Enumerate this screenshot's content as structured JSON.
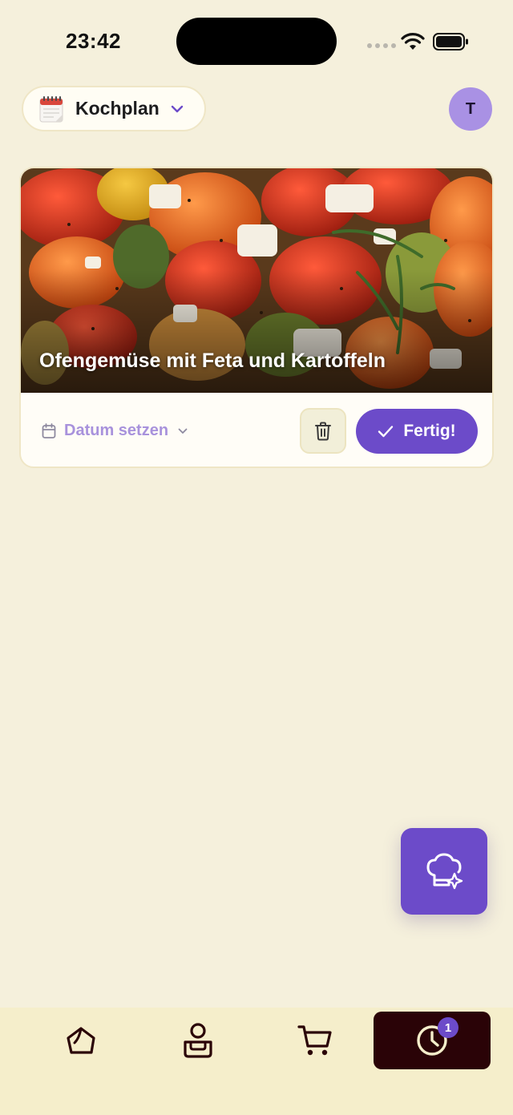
{
  "status_bar": {
    "time": "23:42"
  },
  "header": {
    "plan_selector_label": "Kochplan",
    "avatar_initial": "T"
  },
  "recipe_card": {
    "title": "Ofengemüse mit Feta und Kartoffeln",
    "date_label": "Datum setzen",
    "done_label": "Fertig!"
  },
  "bottom_nav": {
    "items": [
      {
        "icon": "home-icon"
      },
      {
        "icon": "profile-icon"
      },
      {
        "icon": "cart-icon"
      },
      {
        "icon": "history-clock-icon",
        "badge": "1",
        "active": true
      }
    ]
  },
  "colors": {
    "background": "#f5f0dc",
    "accent": "#6c4bc9",
    "active_nav": "#2a0307"
  }
}
